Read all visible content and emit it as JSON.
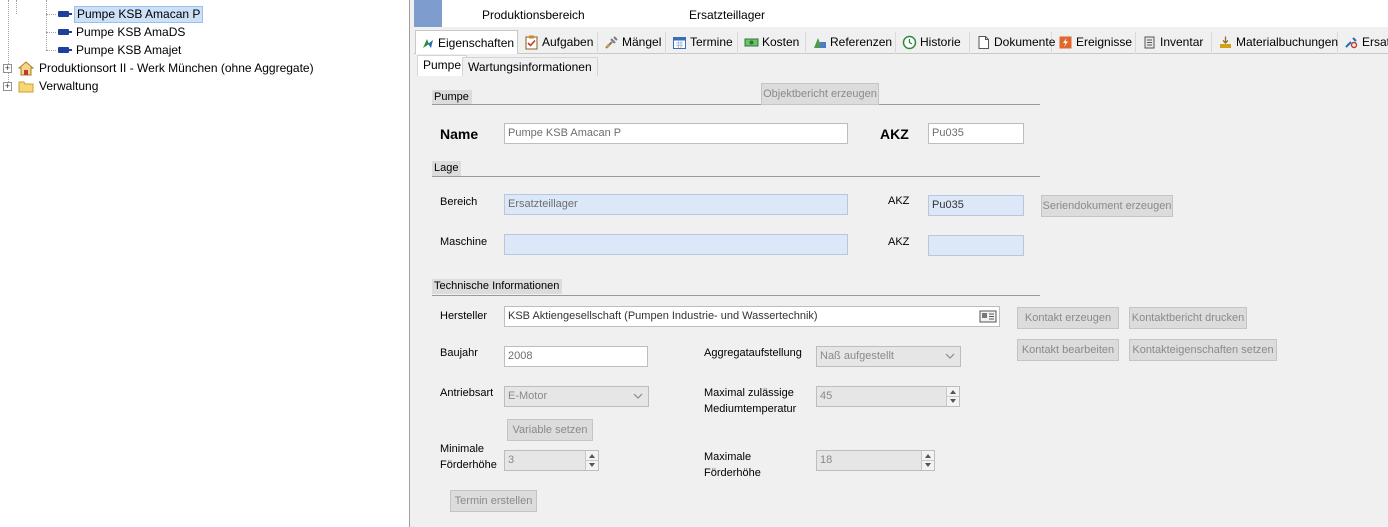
{
  "tree": {
    "items": [
      {
        "label": "Pumpe KSB Amacan P",
        "selected": true
      },
      {
        "label": "Pumpe KSB AmaDS"
      },
      {
        "label": "Pumpe KSB Amajet"
      },
      {
        "label": "Produktionsort II - Werk München (ohne Aggregate)",
        "icon": "house-icon"
      },
      {
        "label": "Verwaltung",
        "icon": "folder-icon"
      }
    ]
  },
  "header": {
    "label": "Produktionsbereich",
    "value": "Ersatzteillager"
  },
  "tabs": [
    {
      "label": "Eigenschaften",
      "icon": "properties-icon",
      "active": true
    },
    {
      "label": "Aufgaben",
      "icon": "clipboard-check-icon"
    },
    {
      "label": "Mängel",
      "icon": "wrench-icon"
    },
    {
      "label": "Termine",
      "icon": "calendar-icon"
    },
    {
      "label": "Kosten",
      "icon": "money-icon"
    },
    {
      "label": "Referenzen",
      "icon": "references-icon"
    },
    {
      "label": "Historie",
      "icon": "history-clock-icon"
    },
    {
      "label": "Dokumente",
      "icon": "document-icon"
    },
    {
      "label": "Ereignisse",
      "icon": "event-icon"
    },
    {
      "label": "Inventar",
      "icon": "inventory-icon"
    },
    {
      "label": "Materialbuchungen",
      "icon": "material-booking-icon"
    },
    {
      "label": "Ersat",
      "icon": "spare-parts-icon"
    }
  ],
  "subtabs": [
    {
      "label": "Pumpe",
      "active": true
    },
    {
      "label": "Wartungsinformationen"
    }
  ],
  "form": {
    "section_pumpe": "Pumpe",
    "btn_objektbericht": "Objektbericht erzeugen",
    "name_label": "Name",
    "name_value": "Pumpe KSB Amacan P",
    "akz_label": "AKZ",
    "akz_value": "Pu035",
    "section_lage": "Lage",
    "bereich_label": "Bereich",
    "bereich_value": "Ersatzteillager",
    "bereich_akz_label": "AKZ",
    "bereich_akz_value": "Pu035",
    "btn_seriendokument": "Seriendokument erzeugen",
    "maschine_label": "Maschine",
    "maschine_value": "",
    "maschine_akz_label": "AKZ",
    "maschine_akz_value": "",
    "section_tech": "Technische Informationen",
    "hersteller_label": "Hersteller",
    "hersteller_value": "KSB Aktiengesellschaft   (Pumpen Industrie- und Wassertechnik)",
    "btn_kontakt_erzeugen": "Kontakt erzeugen",
    "btn_kontaktbericht": "Kontaktbericht drucken",
    "btn_kontakt_bearbeiten": "Kontakt bearbeiten",
    "btn_kontakteigenschaften": "Kontakteigenschaften setzen",
    "baujahr_label": "Baujahr",
    "baujahr_value": "2008",
    "aggregat_label": "Aggregataufstellung",
    "aggregat_value": "Naß aufgestellt",
    "antrieb_label": "Antriebsart",
    "antrieb_value": "E-Motor",
    "maxtemp_label_1": "Maximal zulässige",
    "maxtemp_label_2": "Mediumtemperatur",
    "maxtemp_value": "45",
    "btn_variable": "Variable setzen",
    "minfoerder_label_1": "Minimale",
    "minfoerder_label_2": "Förderhöhe",
    "minfoerder_value": "3",
    "maxfoerder_label_1": "Maximale",
    "maxfoerder_label_2": "Förderhöhe",
    "maxfoerder_value": "18",
    "btn_termin": "Termin erstellen"
  }
}
